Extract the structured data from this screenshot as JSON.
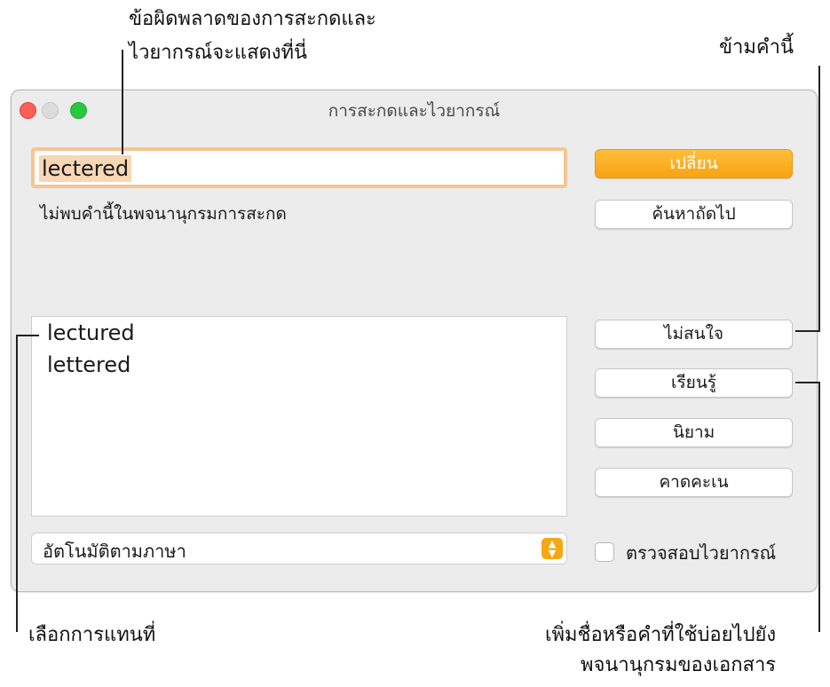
{
  "callouts": {
    "error_line1": "ข้อผิดพลาดของการสะกดและ",
    "error_line2": "ไวยากรณ์จะแสดงที่นี่",
    "skip": "ข้ามคำนี้",
    "choose": "เลือกการแทนที่",
    "add_line1": "เพิ่มชื่อหรือคำที่ใช้บ่อยไปยัง",
    "add_line2": "พจนานุกรมของเอกสาร"
  },
  "window": {
    "title": "การสะกดและไวยากรณ์",
    "word": "lectered",
    "message": "ไม่พบคำนี้ในพจนานุกรมการสะกด",
    "suggestions": [
      "lectured",
      "lettered"
    ],
    "language": "อัตโนมัติตามภาษา",
    "buttons": {
      "change": "เปลี่ยน",
      "find_next": "ค้นหาถัดไป",
      "ignore": "ไม่สนใจ",
      "learn": "เรียนรู้",
      "define": "นิยาม",
      "guess": "คาดคะเน"
    },
    "check_grammar": "ตรวจสอบไวยากรณ์",
    "check_grammar_checked": false
  },
  "colors": {
    "accent": "#f8a313",
    "focus_ring": "#f5c593",
    "close": "#fe5f57",
    "zoom": "#28c840"
  }
}
